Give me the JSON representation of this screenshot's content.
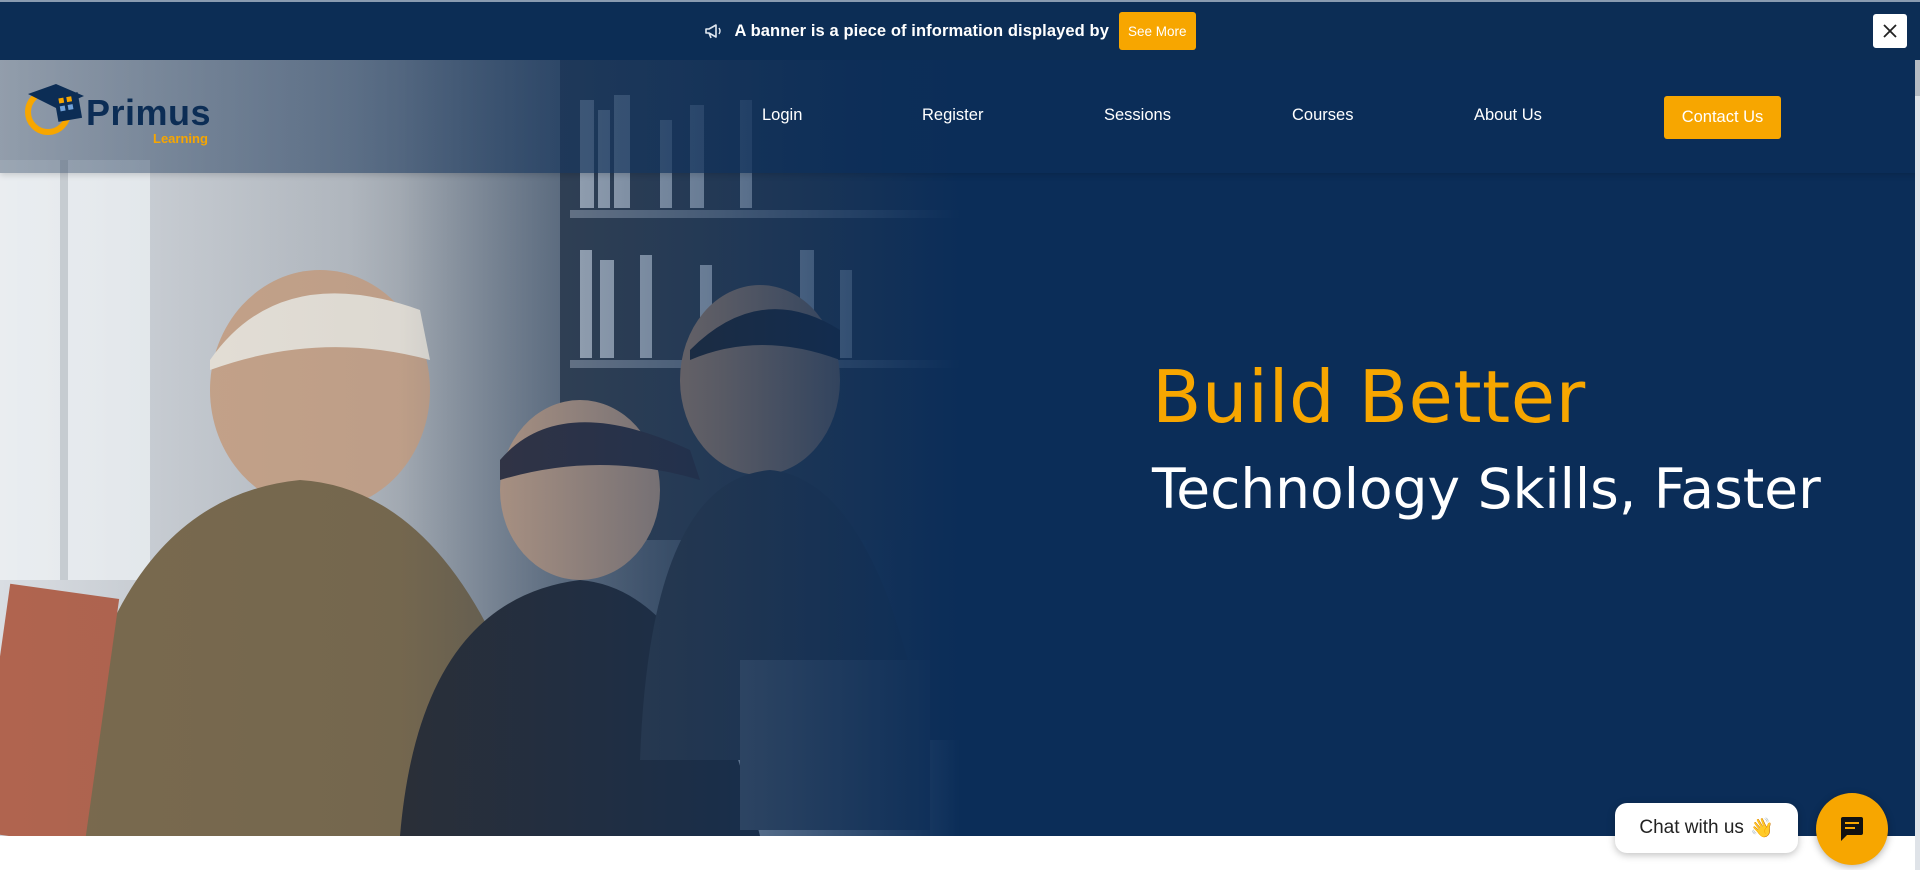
{
  "banner": {
    "text": "A banner is a piece of information displayed by",
    "button_label": "See More",
    "icon": "megaphone-icon",
    "close_icon": "close-icon"
  },
  "brand": {
    "name": "Primus",
    "subtitle": "Learning"
  },
  "nav": {
    "items": [
      {
        "label": "Login"
      },
      {
        "label": "Register"
      },
      {
        "label": "Sessions"
      },
      {
        "label": "Courses"
      },
      {
        "label": "About Us"
      }
    ],
    "cta_label": "Contact Us"
  },
  "hero": {
    "headline": "Build Better",
    "subheadline": "Technology Skills, Faster"
  },
  "chat": {
    "bubble_text": "Chat with us",
    "emoji": "👋",
    "button_icon": "chat-icon"
  },
  "colors": {
    "navy": "#0b2d58",
    "accent": "#f7a600",
    "white": "#ffffff"
  }
}
